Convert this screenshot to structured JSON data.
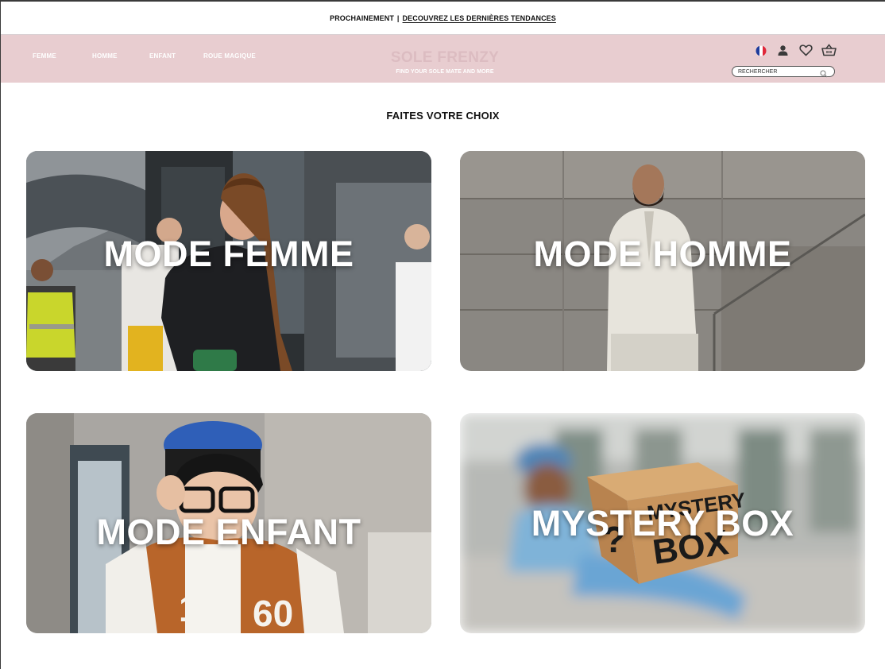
{
  "announcement": {
    "label": "PROCHAINEMENT",
    "separator": "|",
    "link": "DECOUVREZ LES DERNIÈRES TENDANCES"
  },
  "nav": {
    "links": [
      "FEMME",
      "HOMME",
      "ENFANT",
      "ROUE MAGIQUE"
    ],
    "brand": "SOLE FRENZY",
    "tagline": "FIND YOUR SOLE MATE AND MORE",
    "icons": [
      "france-flag-icon",
      "user-icon",
      "heart-icon",
      "basket-icon"
    ],
    "search_placeholder": "RECHERCHER"
  },
  "heading": "FAITES VOTRE CHOIX",
  "cards": [
    {
      "title": "MODE FEMME"
    },
    {
      "title": "MODE HOMME"
    },
    {
      "title": "MODE ENFANT"
    },
    {
      "title": "MYSTERY BOX",
      "box_text": [
        "MYSTERY",
        "BOX"
      ],
      "box_mark": "?"
    }
  ],
  "colors": {
    "nav_bg": "#e8cdd0",
    "brand": "#dcbcc1",
    "text": "#111111"
  }
}
